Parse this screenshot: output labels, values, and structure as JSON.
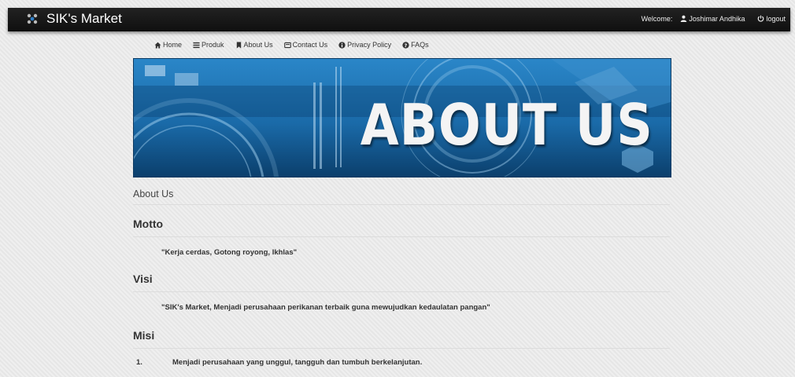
{
  "header": {
    "brand": "SIK's Market",
    "welcome": "Welcome:",
    "user": "Joshimar Andhika",
    "logout": "logout"
  },
  "nav": {
    "home": "Home",
    "produk": "Produk",
    "about": "About Us",
    "contact": "Contact Us",
    "privacy": "Privacy Policy",
    "faqs": "FAQs"
  },
  "banner": {
    "title": "ABOUT US"
  },
  "page": {
    "heading": "About Us",
    "motto_title": "Motto",
    "motto_text": "\"Kerja cerdas, Gotong royong, Ikhlas\"",
    "visi_title": "Visi",
    "visi_text": "\"SIK's Market, Menjadi perusahaan perikanan terbaik guna mewujudkan kedaulatan pangan\"",
    "misi_title": "Misi",
    "misi_items": [
      {
        "num": "1.",
        "text": "Menjadi perusahaan yang unggul, tangguh dan tumbuh berkelanjutan."
      }
    ]
  },
  "colors": {
    "topbar": "#111111",
    "banner_blue": "#1a6aa8",
    "banner_dark": "#0b3f6c"
  },
  "icons": [
    "fish-logo-icon",
    "user-icon",
    "power-icon",
    "home-icon",
    "list-icon",
    "bookmark-icon",
    "contact-card-icon",
    "info-icon",
    "question-icon"
  ]
}
